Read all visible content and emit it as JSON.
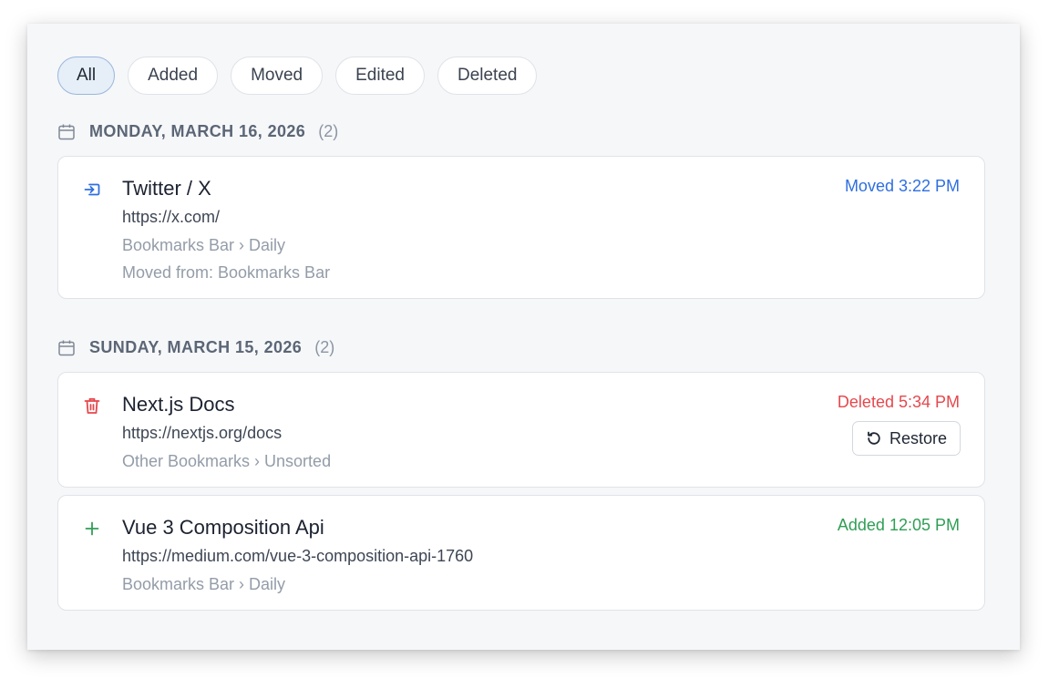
{
  "filters": [
    {
      "label": "All",
      "active": true
    },
    {
      "label": "Added"
    },
    {
      "label": "Moved"
    },
    {
      "label": "Edited"
    },
    {
      "label": "Deleted"
    }
  ],
  "days": [
    {
      "date": "MONDAY, MARCH 16, 2026",
      "count": "(2)",
      "items": [
        {
          "icon": "move-in-icon",
          "title": "Twitter / X",
          "url": "https://x.com/",
          "path": "Bookmarks Bar › Daily",
          "moved_from": "Moved from: Bookmarks Bar",
          "status": "Moved 3:22 PM",
          "status_color": "#2f6fe0"
        }
      ]
    },
    {
      "date": "SUNDAY, MARCH 15, 2026",
      "count": "(2)",
      "items": [
        {
          "icon": "trash-icon",
          "title": "Next.js Docs",
          "url": "https://nextjs.org/docs",
          "path": "Other Bookmarks › Unsorted",
          "status": "Deleted 5:34 PM",
          "status_color": "#e5484d",
          "restore_label": "Restore"
        },
        {
          "icon": "plus-icon",
          "title": "Vue 3 Composition Api",
          "url": "https://medium.com/vue-3-composition-api-1760",
          "path": "Bookmarks Bar › Daily",
          "status": "Added 12:05 PM",
          "status_color": "#2f9e55"
        }
      ]
    }
  ],
  "colors": {
    "moved": "#2f6fe0",
    "deleted": "#e5484d",
    "added": "#2f9e55"
  }
}
